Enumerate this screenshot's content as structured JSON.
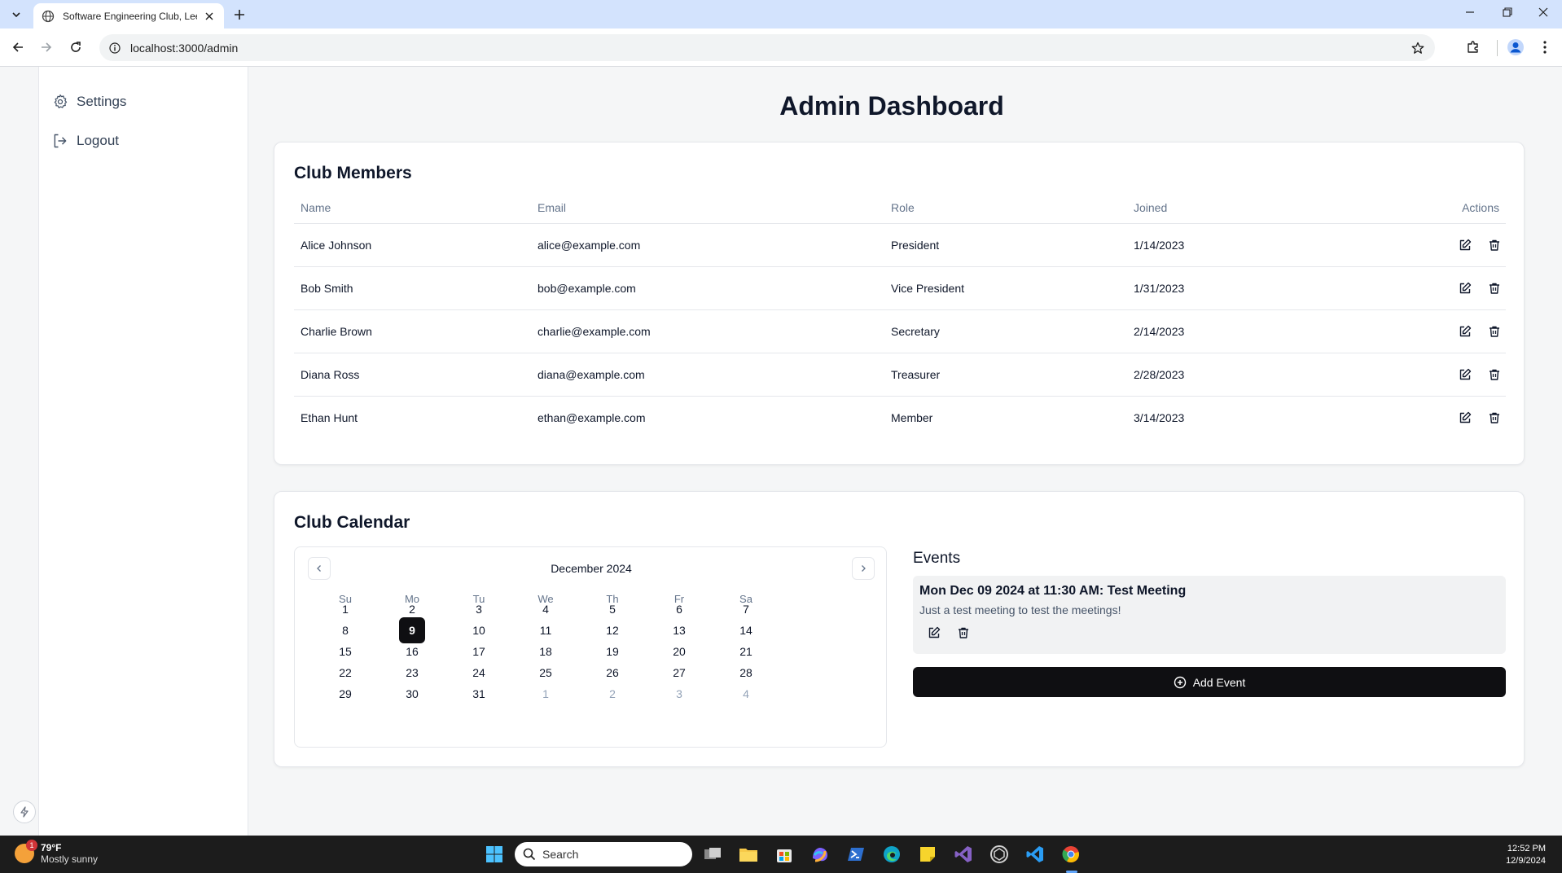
{
  "browser": {
    "tab_title": "Software Engineering Club, Lee",
    "url": "localhost:3000/admin"
  },
  "sidebar": {
    "items": [
      {
        "label": "Settings"
      },
      {
        "label": "Logout"
      }
    ]
  },
  "page": {
    "title": "Admin Dashboard"
  },
  "members": {
    "title": "Club Members",
    "columns": [
      "Name",
      "Email",
      "Role",
      "Joined",
      "Actions"
    ],
    "rows": [
      {
        "name": "Alice Johnson",
        "email": "alice@example.com",
        "role": "President",
        "joined": "1/14/2023"
      },
      {
        "name": "Bob Smith",
        "email": "bob@example.com",
        "role": "Vice President",
        "joined": "1/31/2023"
      },
      {
        "name": "Charlie Brown",
        "email": "charlie@example.com",
        "role": "Secretary",
        "joined": "2/14/2023"
      },
      {
        "name": "Diana Ross",
        "email": "diana@example.com",
        "role": "Treasurer",
        "joined": "2/28/2023"
      },
      {
        "name": "Ethan Hunt",
        "email": "ethan@example.com",
        "role": "Member",
        "joined": "3/14/2023"
      }
    ]
  },
  "calendar": {
    "title": "Club Calendar",
    "month_label": "December 2024",
    "weekdays": [
      "Su",
      "Mo",
      "Tu",
      "We",
      "Th",
      "Fr",
      "Sa"
    ],
    "weeks": [
      [
        "1",
        "2",
        "3",
        "4",
        "5",
        "6",
        "7"
      ],
      [
        "8",
        "9",
        "10",
        "11",
        "12",
        "13",
        "14"
      ],
      [
        "15",
        "16",
        "17",
        "18",
        "19",
        "20",
        "21"
      ],
      [
        "22",
        "23",
        "24",
        "25",
        "26",
        "27",
        "28"
      ],
      [
        "29",
        "30",
        "31",
        "1",
        "2",
        "3",
        "4"
      ]
    ],
    "selected_day": "9"
  },
  "events": {
    "title": "Events",
    "items": [
      {
        "title": "Mon Dec 09 2024 at 11:30 AM: Test Meeting",
        "description": "Just a test meeting to test the meetings!"
      }
    ],
    "add_label": "Add Event"
  },
  "taskbar": {
    "weather_temp": "79°F",
    "weather_desc": "Mostly sunny",
    "weather_badge": "1",
    "search_placeholder": "Search",
    "time": "12:52 PM",
    "date": "12/9/2024"
  },
  "colors": {
    "primary_button": "#0f0f12",
    "tabstrip": "#d3e3fd",
    "page_bg": "#f5f6f7"
  }
}
